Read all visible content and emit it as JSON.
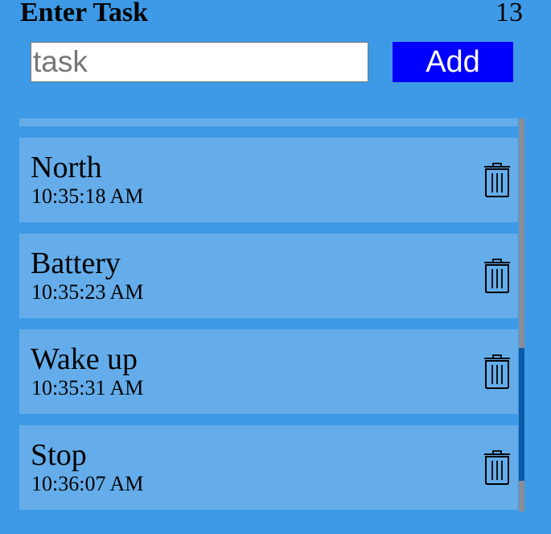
{
  "header": {
    "title": "Enter Task",
    "count": "13"
  },
  "input": {
    "placeholder": "task",
    "value": ""
  },
  "add_button": {
    "label": "Add"
  },
  "tasks": [
    {
      "name": "",
      "time": ""
    },
    {
      "name": "North",
      "time": "10:35:18 AM"
    },
    {
      "name": "Battery",
      "time": "10:35:23 AM"
    },
    {
      "name": "Wake up",
      "time": "10:35:31 AM"
    },
    {
      "name": "Stop",
      "time": "10:36:07 AM"
    }
  ],
  "icons": {
    "delete": "trash-icon"
  },
  "colors": {
    "background": "#3e9ae6",
    "item_background": "#65adea",
    "add_button": "#0000ff",
    "scroll_track": "#898e95",
    "scroll_thumb": "#0a5aa8"
  }
}
